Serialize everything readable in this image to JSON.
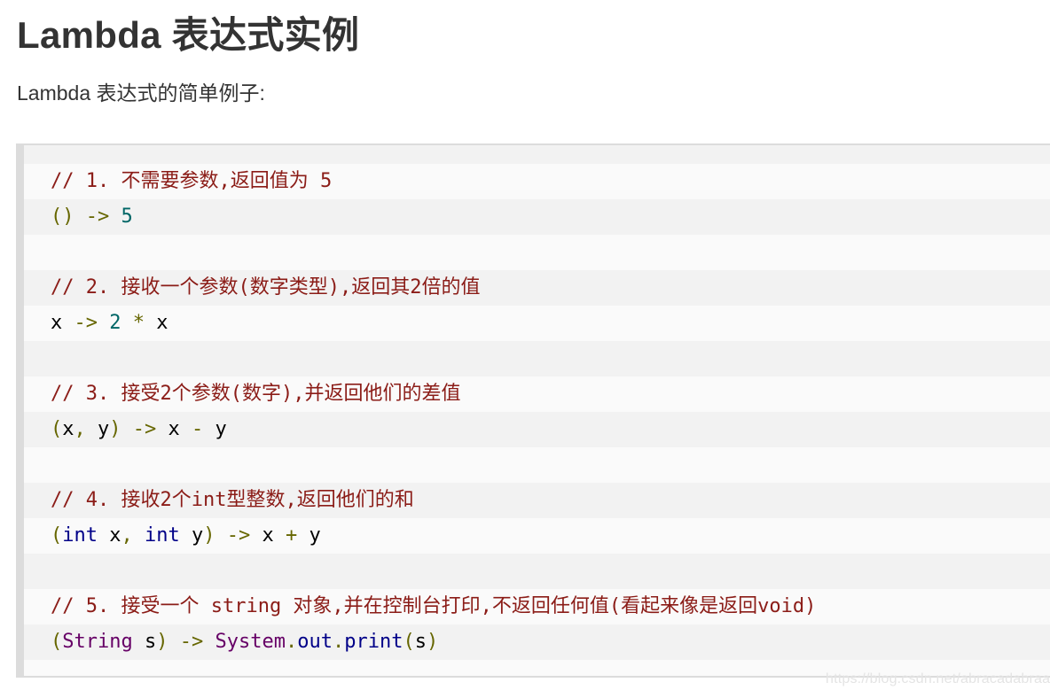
{
  "article": {
    "title": "Lambda 表达式实例",
    "intro": "Lambda 表达式的简单例子:"
  },
  "code_block": {
    "language": "java",
    "lines": [
      [
        {
          "t": "// 1. 不需要参数,返回值为 5",
          "c": "com"
        }
      ],
      [
        {
          "t": "()",
          "c": "pun"
        },
        {
          "t": " ",
          "c": "pln"
        },
        {
          "t": "->",
          "c": "pun"
        },
        {
          "t": " ",
          "c": "pln"
        },
        {
          "t": "5",
          "c": "lit"
        }
      ],
      [],
      [
        {
          "t": "// 2. 接收一个参数(数字类型),返回其2倍的值",
          "c": "com"
        }
      ],
      [
        {
          "t": "x ",
          "c": "pln"
        },
        {
          "t": "->",
          "c": "pun"
        },
        {
          "t": " ",
          "c": "pln"
        },
        {
          "t": "2",
          "c": "lit"
        },
        {
          "t": " ",
          "c": "pln"
        },
        {
          "t": "*",
          "c": "pun"
        },
        {
          "t": " x",
          "c": "pln"
        }
      ],
      [],
      [
        {
          "t": "// 3. 接受2个参数(数字),并返回他们的差值",
          "c": "com"
        }
      ],
      [
        {
          "t": "(",
          "c": "pun"
        },
        {
          "t": "x",
          "c": "pln"
        },
        {
          "t": ",",
          "c": "pun"
        },
        {
          "t": " y",
          "c": "pln"
        },
        {
          "t": ")",
          "c": "pun"
        },
        {
          "t": " ",
          "c": "pln"
        },
        {
          "t": "->",
          "c": "pun"
        },
        {
          "t": " x ",
          "c": "pln"
        },
        {
          "t": "-",
          "c": "pun"
        },
        {
          "t": " y",
          "c": "pln"
        }
      ],
      [],
      [
        {
          "t": "// 4. 接收2个int型整数,返回他们的和",
          "c": "com"
        }
      ],
      [
        {
          "t": "(",
          "c": "pun"
        },
        {
          "t": "int",
          "c": "kwd"
        },
        {
          "t": " x",
          "c": "pln"
        },
        {
          "t": ",",
          "c": "pun"
        },
        {
          "t": " ",
          "c": "pln"
        },
        {
          "t": "int",
          "c": "kwd"
        },
        {
          "t": " y",
          "c": "pln"
        },
        {
          "t": ")",
          "c": "pun"
        },
        {
          "t": " ",
          "c": "pln"
        },
        {
          "t": "->",
          "c": "pun"
        },
        {
          "t": " x ",
          "c": "pln"
        },
        {
          "t": "+",
          "c": "pun"
        },
        {
          "t": " y",
          "c": "pln"
        }
      ],
      [],
      [
        {
          "t": "// 5. 接受一个 string 对象,并在控制台打印,不返回任何值(看起来像是返回void)",
          "c": "com"
        }
      ],
      [
        {
          "t": "(",
          "c": "pun"
        },
        {
          "t": "String",
          "c": "typ"
        },
        {
          "t": " s",
          "c": "pln"
        },
        {
          "t": ")",
          "c": "pun"
        },
        {
          "t": " ",
          "c": "pln"
        },
        {
          "t": "->",
          "c": "pun"
        },
        {
          "t": " ",
          "c": "pln"
        },
        {
          "t": "System",
          "c": "typ"
        },
        {
          "t": ".",
          "c": "pun"
        },
        {
          "t": "out",
          "c": "kwd"
        },
        {
          "t": ".",
          "c": "pun"
        },
        {
          "t": "print",
          "c": "kwd"
        },
        {
          "t": "(",
          "c": "pun"
        },
        {
          "t": "s",
          "c": "pln"
        },
        {
          "t": ")",
          "c": "pun"
        }
      ]
    ]
  },
  "watermark": "https://blog.csdn.net/abracadabraa",
  "colors": {
    "comment": "#8b1c17",
    "punctuation": "#666600",
    "literal": "#006666",
    "keyword": "#000088",
    "type": "#660066",
    "plain": "#000000",
    "code_border": "#dcdcdc",
    "stripe_dark": "#f2f2f2",
    "stripe_light": "#fafafa"
  }
}
